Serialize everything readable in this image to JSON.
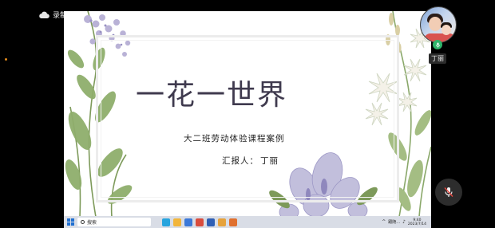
{
  "recording": {
    "label": "录制中",
    "icon": "cloud-icon"
  },
  "slide": {
    "title": "一花一世界",
    "subtitle": "大二班劳动体验课程案例",
    "reporter_label": "汇报人：",
    "reporter_name": "丁丽"
  },
  "taskbar": {
    "search_placeholder": "搜索",
    "apps": [
      "edge-icon",
      "explorer-icon",
      "store-icon",
      "wps-icon",
      "word-icon",
      "folder-icon",
      "app-icon"
    ],
    "tray_text": "跟随...",
    "time": "9:40",
    "date": "2023/7/14"
  },
  "participant": {
    "name": "丁丽"
  },
  "colors": {
    "title": "#3f3a4e",
    "rec_dot": "#e08a1c",
    "mic_green": "#2fb36a",
    "taskbar": "#d9dde6"
  }
}
